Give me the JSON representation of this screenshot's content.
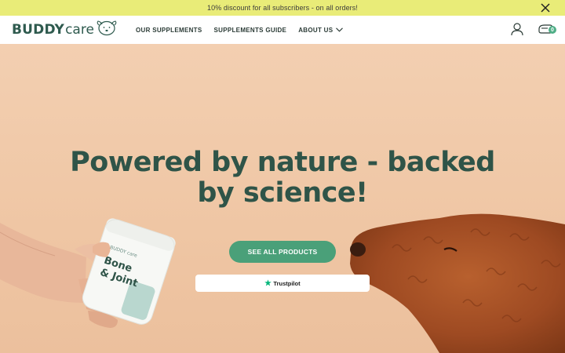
{
  "promo": {
    "text": "10% discount for all subscribers - on all orders!"
  },
  "header": {
    "logo": {
      "brand_bold": "BUDDY",
      "brand_light": "care"
    },
    "nav": [
      {
        "label": "OUR SUPPLEMENTS"
      },
      {
        "label": "SUPPLEMENTS GUIDE"
      },
      {
        "label": "ABOUT US"
      }
    ],
    "cart_count": "0"
  },
  "hero": {
    "headline_line1": "Powered by nature - backed",
    "headline_line2": "by science!",
    "cta_label": "SEE ALL PRODUCTS",
    "trustpilot_label": "Trustpilot",
    "product_label_line1": "Bone",
    "product_label_line2": "& Joint"
  },
  "colors": {
    "promo_bg": "#e9ec78",
    "brand_green": "#2e5a4e",
    "cta_green": "#4aa079",
    "hero_bg": "#f1c9a8"
  }
}
